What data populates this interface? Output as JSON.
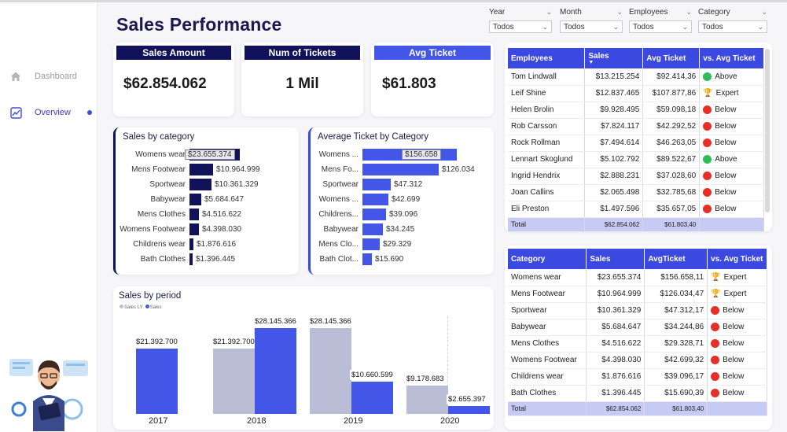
{
  "sidebar": {
    "items": [
      {
        "label": "Dashboard",
        "icon": "home-icon"
      },
      {
        "label": "Overview",
        "icon": "chart-icon"
      }
    ]
  },
  "page": {
    "title": "Sales Performance"
  },
  "filters": [
    {
      "label": "Year",
      "value": "Todos"
    },
    {
      "label": "Month",
      "value": "Todos"
    },
    {
      "label": "Employees",
      "value": "Todos"
    },
    {
      "label": "Category",
      "value": "Todos"
    }
  ],
  "kpis": [
    {
      "label": "Sales Amount",
      "value": "$62.854.062"
    },
    {
      "label": "Num of Tickets",
      "value": "1 Mil"
    },
    {
      "label": "Avg Ticket",
      "value": "$61.803"
    }
  ],
  "sales_by_category": {
    "title": "Sales by category",
    "categories": [
      "Womens wear",
      "Mens Footwear",
      "Sportwear",
      "Babywear",
      "Mens Clothes",
      "Womens Footwear",
      "Childrens wear",
      "Bath Clothes"
    ],
    "labels": [
      "$23.655.374",
      "$10.964.999",
      "$10.361.329",
      "$5.684.647",
      "$4.516.622",
      "$4.398.030",
      "$1.876.616",
      "$1.396.445"
    ],
    "values": [
      23655374,
      10964999,
      10361329,
      5684647,
      4516622,
      4398030,
      1876616,
      1396445
    ],
    "color": "#12125a"
  },
  "avg_ticket_by_category": {
    "title": "Average Ticket by Category",
    "categories": [
      "Womens ...",
      "Mens Fo...",
      "Sportwear",
      "Womens ...",
      "Childrens...",
      "Babywear",
      "Mens Clo...",
      "Bath Clot..."
    ],
    "labels": [
      "$156.658",
      "$126.034",
      "$47.312",
      "$42.699",
      "$39.096",
      "$34.245",
      "$29.329",
      "$15.690"
    ],
    "values": [
      156658,
      126034,
      47312,
      42699,
      39096,
      34245,
      29329,
      15690
    ],
    "color": "#4356e8"
  },
  "chart_data": {
    "type": "bar",
    "title": "Sales by period",
    "categories": [
      "2017",
      "2018",
      "2019",
      "2020"
    ],
    "series": [
      {
        "name": "Sales LY",
        "values": [
          null,
          21392700,
          28145366,
          9178683
        ],
        "labels": [
          "",
          "$21.392.700",
          "$28.145.366",
          "$9.178.683"
        ],
        "color": "#b9bdd6"
      },
      {
        "name": "Sales",
        "values": [
          21392700,
          28145366,
          10660599,
          2655397
        ],
        "labels": [
          "$21.392.700",
          "$28.145.366",
          "$10.660.599",
          "$2.655.397"
        ],
        "color": "#4356e8"
      }
    ],
    "ylim": [
      0,
      28145366
    ],
    "grid": false,
    "legend": "top-left"
  },
  "employees_table": {
    "headers": [
      "Employees",
      "Sales",
      "Avg Ticket",
      "vs. Avg Ticket"
    ],
    "rows": [
      {
        "name": "Tom Lindwall",
        "sales": "$13.215.254",
        "avg": "$92.414,36",
        "status": "Above",
        "icon": "green"
      },
      {
        "name": "Leif Shine",
        "sales": "$12.837.465",
        "avg": "$107.877,86",
        "status": "Expert",
        "icon": "trophy"
      },
      {
        "name": "Helen Brolin",
        "sales": "$9.928.495",
        "avg": "$59.098,18",
        "status": "Below",
        "icon": "red"
      },
      {
        "name": "Rob Carsson",
        "sales": "$7.824.117",
        "avg": "$42.292,52",
        "status": "Below",
        "icon": "red"
      },
      {
        "name": "Rock Rollman",
        "sales": "$7.494.614",
        "avg": "$46.263,05",
        "status": "Below",
        "icon": "red"
      },
      {
        "name": "Lennart Skoglund",
        "sales": "$5.102.792",
        "avg": "$89.522,67",
        "status": "Above",
        "icon": "green"
      },
      {
        "name": "Ingrid Hendrix",
        "sales": "$2.888.231",
        "avg": "$37.028,60",
        "status": "Below",
        "icon": "red"
      },
      {
        "name": "Joan Callins",
        "sales": "$2.065.498",
        "avg": "$32.785,68",
        "status": "Below",
        "icon": "red"
      },
      {
        "name": "Eli Preston",
        "sales": "$1.497.596",
        "avg": "$35.657,05",
        "status": "Below",
        "icon": "red"
      }
    ],
    "total": {
      "label": "Total",
      "sales": "$62.854.062",
      "avg": "$61.803,40"
    }
  },
  "category_table": {
    "headers": [
      "Category",
      "Sales",
      "AvgTicket",
      "vs. Avg Ticket"
    ],
    "rows": [
      {
        "name": "Womens wear",
        "sales": "$23.655.374",
        "avg": "$156.658,11",
        "status": "Expert",
        "icon": "trophy"
      },
      {
        "name": "Mens Footwear",
        "sales": "$10.964.999",
        "avg": "$126.034,47",
        "status": "Expert",
        "icon": "trophy"
      },
      {
        "name": "Sportwear",
        "sales": "$10.361.329",
        "avg": "$47.312,17",
        "status": "Below",
        "icon": "red"
      },
      {
        "name": "Babywear",
        "sales": "$5.684.647",
        "avg": "$34.244,86",
        "status": "Below",
        "icon": "red"
      },
      {
        "name": "Mens Clothes",
        "sales": "$4.516.622",
        "avg": "$29.328,71",
        "status": "Below",
        "icon": "red"
      },
      {
        "name": "Womens Footwear",
        "sales": "$4.398.030",
        "avg": "$42.699,32",
        "status": "Below",
        "icon": "red"
      },
      {
        "name": "Childrens wear",
        "sales": "$1.876.616",
        "avg": "$39.096,17",
        "status": "Below",
        "icon": "red"
      },
      {
        "name": "Bath Clothes",
        "sales": "$1.396.445",
        "avg": "$15.690,39",
        "status": "Below",
        "icon": "red"
      }
    ],
    "total": {
      "label": "Total",
      "sales": "$62.854.062",
      "avg": "$61.803,40"
    }
  }
}
